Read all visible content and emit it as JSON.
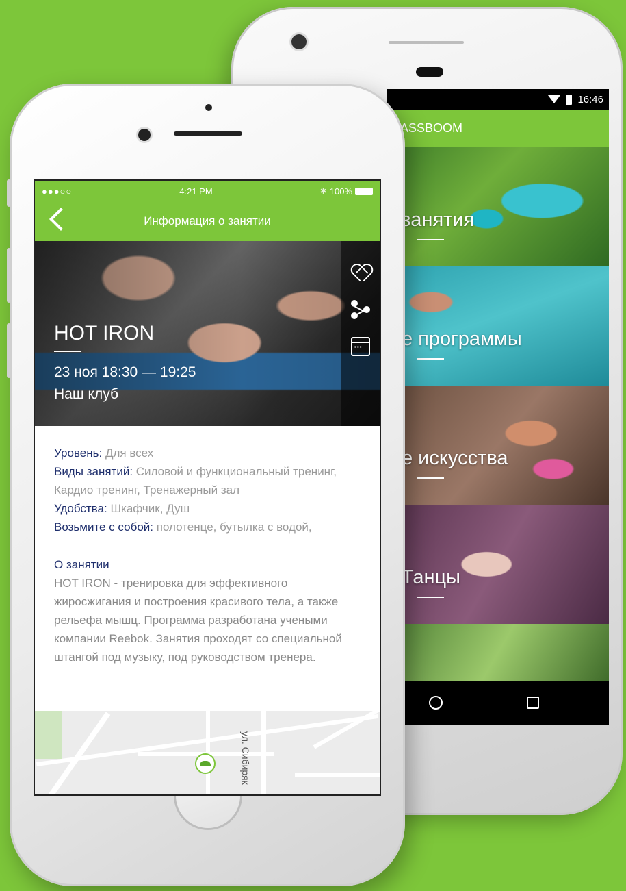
{
  "back_phone": {
    "status": {
      "time": "16:46"
    },
    "app_title": "ASSBOOM",
    "tiles": [
      {
        "label": "занятия"
      },
      {
        "label": "е программы"
      },
      {
        "label": "е искусства"
      },
      {
        "label": "Танцы"
      },
      {
        "label": ""
      }
    ]
  },
  "front_phone": {
    "status": {
      "signal": "●●●○○",
      "time": "4:21 PM",
      "battery": "100%"
    },
    "nav_title": "Информация о занятии",
    "class": {
      "name": "HOT IRON",
      "when": "23 ноя 18:30 — 19:25",
      "where": "Наш клуб"
    },
    "details": {
      "level_key": "Уровень:",
      "level_val": "Для всех",
      "types_key": "Виды занятий:",
      "types_val": "Силовой и функциональный тренинг, Кардио тренинг, Тренажерный зал",
      "amenities_key": "Удобства:",
      "amenities_val": "Шкафчик, Душ",
      "bring_key": "Возьмите с собой:",
      "bring_val": "полотенце, бутылка с водой,"
    },
    "about": {
      "heading": "О занятии",
      "text": "HOT IRON - тренировка для эффективного жиросжигания и построения красивого тела, а также рельефа мышц. Программа разработана учеными компании Reebok. Занятия проходят со специальной штангой под музыку, под руководством тренера."
    },
    "map": {
      "street": "ул. Сибиряк"
    }
  },
  "colors": {
    "accent": "#7dc63a",
    "label_dark": "#1f2f6d",
    "text_gray": "#9a9a9a"
  }
}
